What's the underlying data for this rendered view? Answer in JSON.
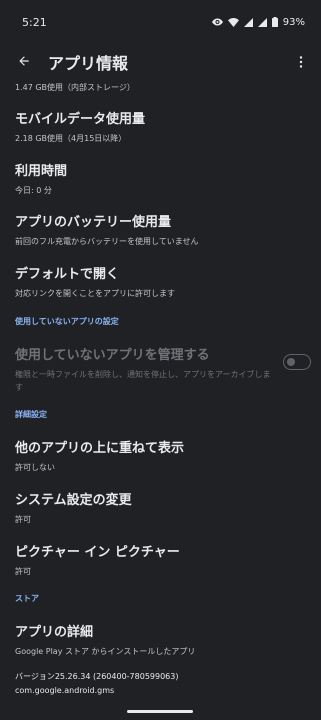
{
  "status_bar": {
    "time": "5:21",
    "battery": "93%"
  },
  "app_bar": {
    "title": "アプリ情報"
  },
  "items": {
    "storage_partial": {
      "subtitle": "1.47 GB使用（内部ストレージ）"
    },
    "mobile_data": {
      "title": "モバイルデータ使用量",
      "subtitle": "2.18 GB使用（4月15日以降）"
    },
    "screen_time": {
      "title": "利用時間",
      "subtitle": "今日: 0 分"
    },
    "battery": {
      "title": "アプリのバッテリー使用量",
      "subtitle": "前回のフル充電からバッテリーを使用していません"
    },
    "open_by_default": {
      "title": "デフォルトで開く",
      "subtitle": "対応リンクを開くことをアプリに許可します"
    },
    "unused_section": {
      "header": "使用していないアプリの設定"
    },
    "manage_unused": {
      "title": "使用していないアプリを管理する",
      "subtitle": "権限と一時ファイルを削除し、通知を停止し、アプリをアーカイブします",
      "toggle_on": false
    },
    "advanced_section": {
      "header": "詳細設定"
    },
    "display_over": {
      "title": "他のアプリの上に重ねて表示",
      "subtitle": "許可しない"
    },
    "modify_system": {
      "title": "システム設定の変更",
      "subtitle": "許可"
    },
    "pip": {
      "title": "ピクチャー イン ピクチャー",
      "subtitle": "許可"
    },
    "store_section": {
      "header": "ストア"
    },
    "app_details": {
      "title": "アプリの詳細",
      "subtitle": "Google Play ストア からインストールしたアプリ"
    }
  },
  "footer": {
    "version": "バージョン25.26.34 (260400-780599063)",
    "package": "com.google.android.gms"
  },
  "icons": {
    "back": "arrow-back-icon",
    "more": "more-vert-icon"
  }
}
